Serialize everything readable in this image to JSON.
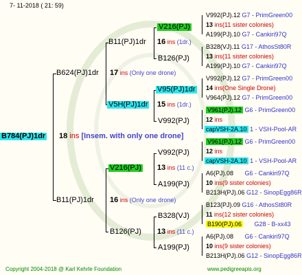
{
  "header": {
    "date": "7- 11-2018 ( 21: 59)"
  },
  "gen1": {
    "root": "B784(PJ)1dr",
    "num": "18",
    "ins": "ins",
    "note": "[Insem. with only one drone]"
  },
  "gen2": [
    {
      "label": "B624(PJ)1dr",
      "num": "17",
      "ins": "ins",
      "note": "(Only one drone)"
    },
    {
      "label": "B11(PJ)1dr",
      "num": "16",
      "ins": "ins",
      "note": "(Only one drone)"
    }
  ],
  "gen3": [
    {
      "label": "B11(PJ)1dr",
      "num": "16",
      "ins": "ins",
      "note": "(1dr.)"
    },
    {
      "label": "V5H(PJ)1dr",
      "num": "15",
      "ins": "ins",
      "note": "(1dr.)"
    },
    {
      "label": "V216(PJ)",
      "num": "13",
      "ins": "ins",
      "note": "(11 c.)"
    },
    {
      "label": "B126(PJ)",
      "num": "13",
      "ins": "ins",
      "note": "(11 c.)"
    }
  ],
  "gen4": [
    {
      "label": "V216(PJ)"
    },
    {
      "label": "B126(PJ)"
    },
    {
      "label": "V95(PJ)1dr"
    },
    {
      "label": "V992(PJ)"
    },
    {
      "label": "V992(PJ)"
    },
    {
      "label": "A199(PJ)"
    },
    {
      "label": "B328(VJ)"
    },
    {
      "label": "A199(PJ)"
    }
  ],
  "gen5": [
    {
      "a": "V992(PJ).12",
      "a_src": "G7 - PrimGreen00",
      "m": "13",
      "m_txt": "ins(11 sister colonies)",
      "b": "A199(PJ).10",
      "b_src": "G7 - Cankiri97Q"
    },
    {
      "a": "B328(VJ).11",
      "a_src": "G17 - AthosSt80R",
      "m": "13",
      "m_txt": "ins(11 sister colonies)",
      "b": "A199(PJ).10",
      "b_src": "G7 - Cankiri97Q"
    },
    {
      "a": "V992(PJ).12",
      "a_src": "G7 - PrimGreen00",
      "m": "14",
      "m_txt": "ins(One Single Drone)",
      "b": "V964(PJ).12",
      "b_src": "G7 - PrimGreen00"
    },
    {
      "a": "V961(PJ).12",
      "a_src": "G6 - PrimGreen00",
      "m": "12",
      "m_txt": "ins",
      "b": "capVSH-2A.10",
      "b_src": "1 - VSH-Pool-AR"
    },
    {
      "a": "V961(PJ).12",
      "a_src": "G6 - PrimGreen00",
      "m": "12",
      "m_txt": "ins",
      "b": "capVSH-2A.10",
      "b_src": "1 - VSH-Pool-AR"
    },
    {
      "a": "A6(PJ).08",
      "a_src": "G6 - Cankiri97Q",
      "m": "10",
      "m_txt": "ins(9 sister colonies)",
      "b": "B213H(PJ).06",
      "b_src": "G12 - SinopEgg86R"
    },
    {
      "a": "B123(PJ).09",
      "a_src": "G16 - AthosSt80R",
      "m": "11",
      "m_txt": "ins(12 sister colonies)",
      "b": "B190(PJ).06",
      "b_src": "G28 - B-xx43"
    },
    {
      "a": "A6(PJ).08",
      "a_src": "G6 - Cankiri97Q",
      "m": "10",
      "m_txt": "ins(9 sister colonies)",
      "b": "B213H(PJ).06",
      "b_src": "G12 - SinopEgg86R"
    }
  ],
  "footer": {
    "copyright": "Copyright 2004-2018 @ Karl Kehrle Foundation",
    "site": "www.pedigreeapis.org"
  },
  "colors": {
    "green": "#22cc22",
    "cyan": "#2ee6ee",
    "yellow": "#ffff00",
    "red": "#cc0000",
    "blue": "#3333cc"
  }
}
